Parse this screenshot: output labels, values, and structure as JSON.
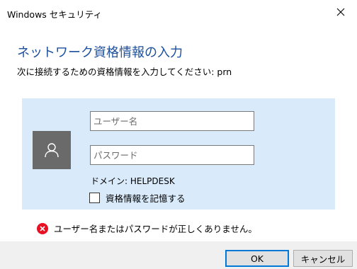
{
  "window": {
    "title": "Windows セキュリティ"
  },
  "header": {
    "title": "ネットワーク資格情報の入力",
    "subtitle": "次に接続するための資格情報を入力してください: prn"
  },
  "credentials": {
    "username_placeholder": "ユーザー名",
    "username_value": "",
    "password_placeholder": "パスワード",
    "password_value": "",
    "domain_label": "ドメイン: HELPDESK",
    "remember_label": "資格情報を記憶する",
    "remember_checked": false
  },
  "error": {
    "message": "ユーザー名またはパスワードが正しくありません。",
    "icon": "error-icon"
  },
  "buttons": {
    "ok": "OK",
    "cancel": "キャンセル"
  },
  "colors": {
    "accent": "#1b4f9c",
    "panel": "#d9ebfb",
    "error": "#e81123",
    "avatar_bg": "#6a6a6a"
  }
}
